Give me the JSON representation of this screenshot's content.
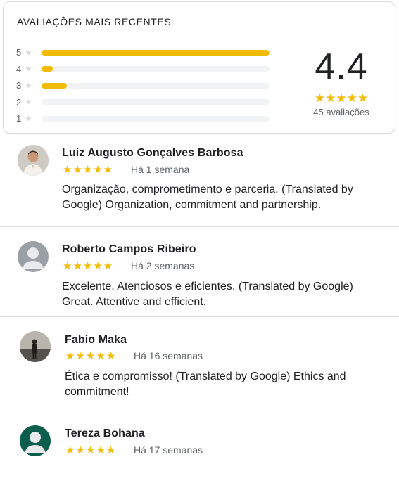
{
  "summary": {
    "title": "AVALIAÇÕES MAIS RECENTES",
    "rating": "4.4",
    "stars": "★★★★★",
    "count_text": "45 avaliações",
    "distribution": [
      {
        "label": "5",
        "star": "★",
        "fraction": 1.0
      },
      {
        "label": "4",
        "star": "★",
        "fraction": 0.05
      },
      {
        "label": "3",
        "star": "★",
        "fraction": 0.11
      },
      {
        "label": "2",
        "star": "★",
        "fraction": 0.0
      },
      {
        "label": "1",
        "star": "★",
        "fraction": 0.0
      }
    ]
  },
  "reviews": [
    {
      "name": "Luiz Augusto Gonçalves Barbosa",
      "stars": "★★★★★",
      "time": "Há 1 semana",
      "text": "Organização, comprometimento e parceria. (Translated by Google) Organization, commitment and partnership."
    },
    {
      "name": "Roberto Campos Ribeiro",
      "stars": "★★★★★",
      "time": "Há 2 semanas",
      "text": "Excelente. Atenciosos e eficientes. (Translated by Google) Great. Attentive and efficient."
    },
    {
      "name": "Fabio Maka",
      "stars": "★★★★★",
      "time": "Há 16 semanas",
      "text": "Ética e compromisso! (Translated by Google) Ethics and commitment!"
    },
    {
      "name": "Tereza Bohana",
      "stars": "★★★★★",
      "time": "Há 17 semanas",
      "text": ""
    }
  ],
  "colors": {
    "star": "#f2bb05",
    "empty_star": "#dadce0",
    "track": "#f1f3f4",
    "avatar_gray": "#9aa0a6",
    "avatar_green": "#0b5e4d"
  }
}
